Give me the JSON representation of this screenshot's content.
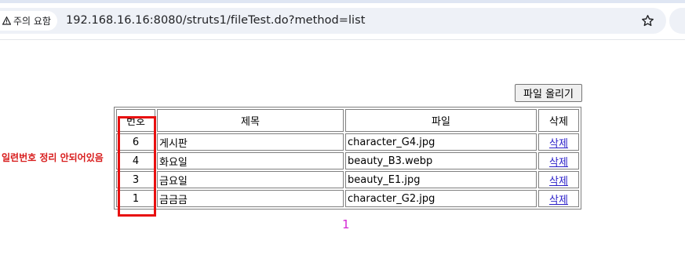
{
  "browser": {
    "security_label": "주의 요함",
    "url": "192.168.16.16:8080/struts1/fileTest.do?method=list"
  },
  "page": {
    "upload_button": "파일 올리기",
    "headers": {
      "no": "번호",
      "title": "제목",
      "file": "파일",
      "delete": "삭제"
    },
    "rows": [
      {
        "no": "6",
        "title": "게시판",
        "file": "character_G4.jpg",
        "delete": "삭제"
      },
      {
        "no": "4",
        "title": "화요일",
        "file": "beauty_B3.webp",
        "delete": "삭제"
      },
      {
        "no": "3",
        "title": "금요일",
        "file": "beauty_E1.jpg",
        "delete": "삭제"
      },
      {
        "no": "1",
        "title": "금금금",
        "file": "character_G2.jpg",
        "delete": "삭제"
      }
    ],
    "annotation": "일련번호 정리 안되어있음",
    "pagination": "1"
  },
  "colors": {
    "annotation": "#e81010",
    "pagination": "#d426d4",
    "link": "#2a1ec8"
  }
}
